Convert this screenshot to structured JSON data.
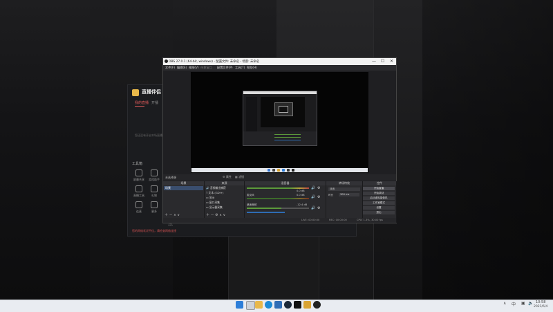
{
  "obs": {
    "title": "OBS 27.0.1 (64-bit, windows) - 配置文件: 未命名 - 场景: 未命名",
    "window_buttons": [
      "—",
      "☐",
      "✕"
    ],
    "menu": [
      "文件(F)",
      "编辑(E)",
      "视图(V)",
      "停靠窗口",
      "配置文件(P)",
      "工具(T)",
      "帮助(H)"
    ],
    "scene_label": "未选择源",
    "preview_controls": [
      "属性",
      "滤镜"
    ],
    "docks": {
      "scenes": "场景",
      "sources": "来源",
      "mixer": "混音器",
      "transitions": "转场特效",
      "controls": "控件"
    },
    "scenes_list": [
      "场景"
    ],
    "sources_list": [
      "音频输出捕获",
      "文本 (GDI+)",
      "显示",
      "窗口采集",
      "显示器采集"
    ],
    "mixer": [
      {
        "name": "",
        "db": "0.0 dB"
      },
      {
        "name": "麦克风",
        "db": "0.0 dB"
      },
      {
        "name": "桌面音频",
        "db": "-12.4 dB"
      }
    ],
    "transitions": {
      "type": "淡出",
      "duration_label": "时长",
      "duration": "300 ms"
    },
    "controls": [
      "开始直播",
      "开始录制",
      "启动虚拟摄像机",
      "工作室模式",
      "设置",
      "退出"
    ],
    "status": [
      "LIVE: 00:00:00",
      "REC: 00:00:00",
      "CPU: 1.3%, 30.00 fps"
    ]
  },
  "helper": {
    "title": "直播伴侣",
    "tabs": [
      "我的直播",
      "开播"
    ],
    "message": "您还没有开启本场直播哦",
    "section": "工具箱",
    "tools": [
      "屏幕共享",
      "游戏助手",
      "直播工具",
      "礼物",
      "连麦",
      "更多"
    ],
    "warning": "您的网络状况不佳，请检查网络连接"
  },
  "taskbar": {
    "time": "10:58",
    "date": "2021/6/4",
    "lang": "中"
  }
}
